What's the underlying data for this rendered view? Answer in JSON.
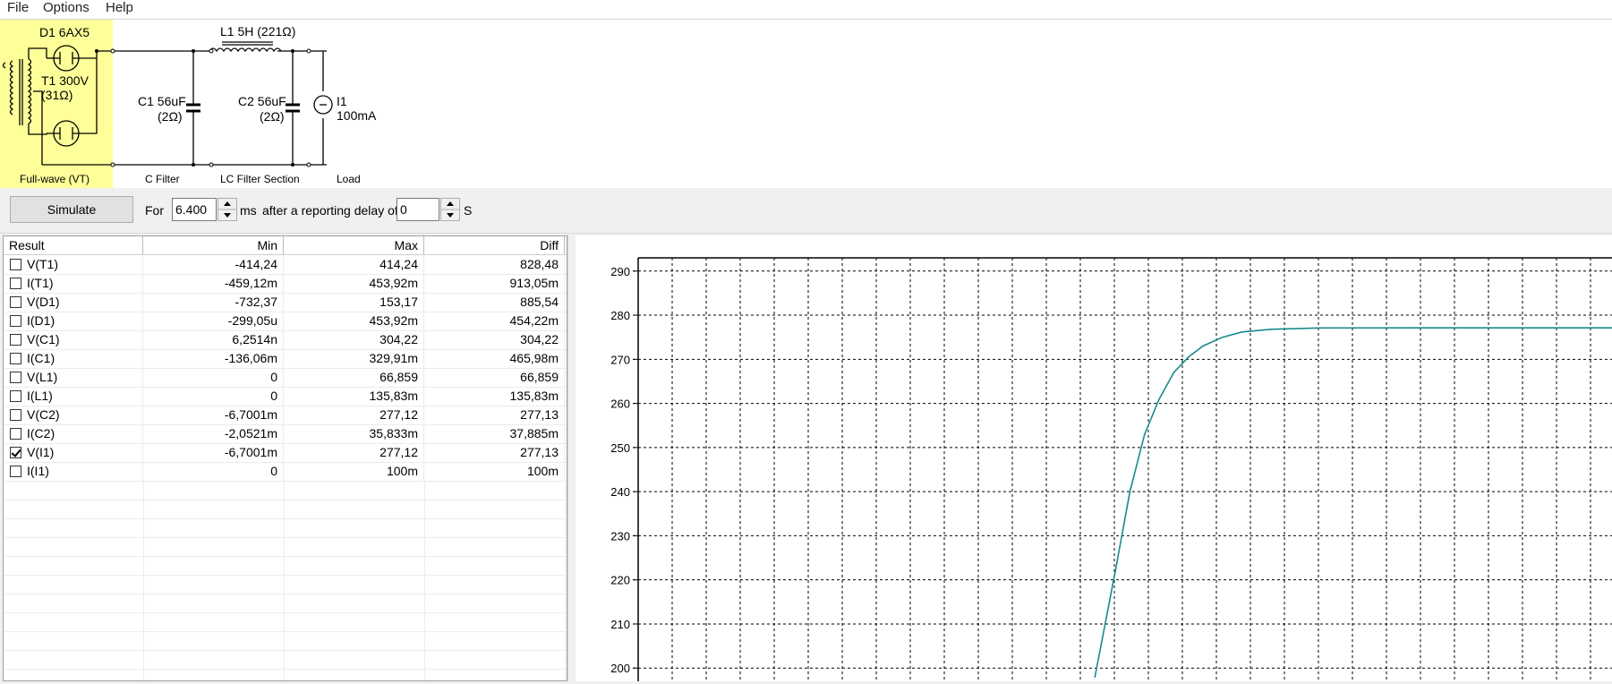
{
  "menu": {
    "items": [
      "File",
      "Options",
      "Help"
    ]
  },
  "schematic": {
    "d1_label": "D1 6AX5",
    "t1_label_1": "T1 300V",
    "t1_label_2": "(31Ω)",
    "l1_label": "L1 5H (221Ω)",
    "c1_label_1": "C1 56uF",
    "c1_label_2": "(2Ω)",
    "c2_label_1": "C2 56uF",
    "c2_label_2": "(2Ω)",
    "i1_label_1": "I1",
    "i1_label_2": "100mA",
    "section_rectifier": "Full-wave (VT)",
    "section_cfilter": "C Filter",
    "section_lcfilter": "LC Filter Section",
    "section_load": "Load",
    "highlight_color": "#ffff99"
  },
  "toolbar": {
    "simulate_label": "Simulate",
    "for_label": "For",
    "duration_value": "6.400",
    "duration_unit": "ms",
    "delay_label": "after a reporting delay of",
    "delay_value": "0",
    "delay_unit": "S"
  },
  "results": {
    "headers": [
      "Result",
      "Min",
      "Max",
      "Diff"
    ],
    "rows": [
      {
        "name": "V(T1)",
        "min": "-414,24",
        "max": "414,24",
        "diff": "828,48",
        "checked": false
      },
      {
        "name": "I(T1)",
        "min": "-459,12m",
        "max": "453,92m",
        "diff": "913,05m",
        "checked": false
      },
      {
        "name": "V(D1)",
        "min": "-732,37",
        "max": "153,17",
        "diff": "885,54",
        "checked": false
      },
      {
        "name": "I(D1)",
        "min": "-299,05u",
        "max": "453,92m",
        "diff": "454,22m",
        "checked": false
      },
      {
        "name": "V(C1)",
        "min": "6,2514n",
        "max": "304,22",
        "diff": "304,22",
        "checked": false
      },
      {
        "name": "I(C1)",
        "min": "-136,06m",
        "max": "329,91m",
        "diff": "465,98m",
        "checked": false
      },
      {
        "name": "V(L1)",
        "min": "0",
        "max": "66,859",
        "diff": "66,859",
        "checked": false
      },
      {
        "name": "I(L1)",
        "min": "0",
        "max": "135,83m",
        "diff": "135,83m",
        "checked": false
      },
      {
        "name": "V(C2)",
        "min": "-6,7001m",
        "max": "277,12",
        "diff": "277,13",
        "checked": false
      },
      {
        "name": "I(C2)",
        "min": "-2,0521m",
        "max": "35,833m",
        "diff": "37,885m",
        "checked": false
      },
      {
        "name": "V(I1)",
        "min": "-6,7001m",
        "max": "277,12",
        "diff": "277,13",
        "checked": true
      },
      {
        "name": "I(I1)",
        "min": "0",
        "max": "100m",
        "diff": "100m",
        "checked": false
      }
    ]
  },
  "chart_data": {
    "type": "line",
    "ylim": [
      197,
      293
    ],
    "yticks": [
      200,
      210,
      220,
      230,
      240,
      250,
      260,
      270,
      280,
      290
    ],
    "xlim": [
      0,
      1
    ],
    "grid": true,
    "series_color": "#1a8a8a",
    "series": [
      {
        "x": [
          0.469,
          0.49,
          0.505,
          0.52,
          0.535,
          0.55,
          0.565,
          0.58,
          0.6,
          0.62,
          0.65,
          0.7,
          0.8,
          1.0
        ],
        "y": [
          198,
          222,
          240,
          253,
          261,
          267,
          270.5,
          273,
          275,
          276.2,
          276.8,
          277.1,
          277.12,
          277.12
        ]
      }
    ]
  }
}
